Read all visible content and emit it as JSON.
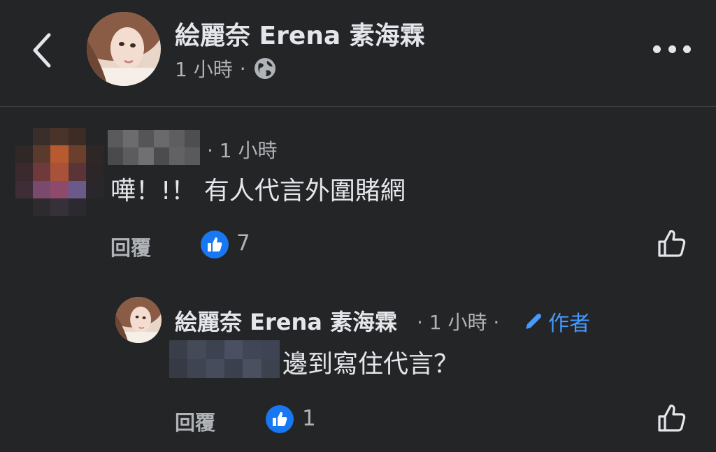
{
  "header": {
    "page_name": "絵麗奈 Erena 素海霖",
    "time": "1 小時",
    "separator": "·",
    "audience_icon": "globe-icon",
    "back_icon": "chevron-left-icon",
    "more_icon": "more-dots-icon"
  },
  "comment": {
    "time": "· 1 小時",
    "text": "嘩！!！ 有人代言外圍賭網",
    "reply_label": "回覆",
    "like_count": "7",
    "like_icon": "thumbs-up-icon"
  },
  "reply": {
    "author": "絵麗奈 Erena 素海霖",
    "time": "· 1 小時 ·",
    "author_badge": "作者",
    "text": "邊到寫住代言？",
    "reply_label": "回覆",
    "like_count": "1",
    "like_icon": "thumbs-up-icon"
  },
  "colors": {
    "background": "#242526",
    "text": "#e4e6eb",
    "secondary": "#b0b3b8",
    "accent": "#4599ff",
    "like_blue": "#1877f2"
  }
}
